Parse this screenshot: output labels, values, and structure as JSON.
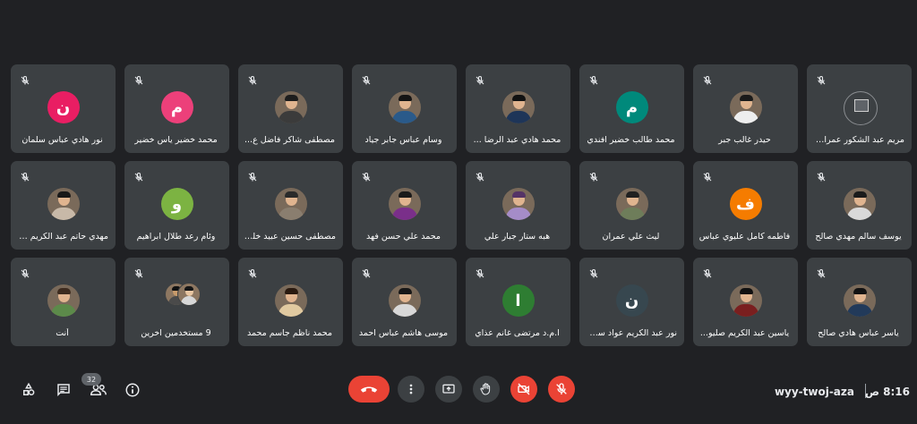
{
  "participants": [
    {
      "name": "مريم عبد الشكور عمران...",
      "avatar": {
        "kind": "broken"
      }
    },
    {
      "name": "حيدر غالب جبر",
      "avatar": {
        "kind": "photo",
        "shirt": "#eeeeee",
        "hair": "#1a1a1a"
      }
    },
    {
      "name": "محمد طالب خضير افندي",
      "avatar": {
        "kind": "letter",
        "letter": "م",
        "color": "#00897b"
      }
    },
    {
      "name": "محمد هادي عبد الرضا ...",
      "avatar": {
        "kind": "photo",
        "shirt": "#1e3558",
        "hair": "#111111"
      }
    },
    {
      "name": "وسام عباس جابر جياد",
      "avatar": {
        "kind": "photo",
        "shirt": "#2a5a8a",
        "hair": "#141414"
      }
    },
    {
      "name": "مصطفى شاكر فاضل ع...",
      "avatar": {
        "kind": "photo",
        "shirt": "#3b3b3b",
        "hair": "#1d1d1d"
      }
    },
    {
      "name": "محمد خضير ياس خضير",
      "avatar": {
        "kind": "letter",
        "letter": "م",
        "color": "#ec407a"
      }
    },
    {
      "name": "نور هادي عباس سلمان",
      "avatar": {
        "kind": "letter",
        "letter": "ن",
        "color": "#e91e63"
      }
    },
    {
      "name": "يوسف سالم مهدي صالح",
      "avatar": {
        "kind": "photo",
        "shirt": "#d9d9d9",
        "hair": "#1b1b1b"
      }
    },
    {
      "name": "فاطمه كامل عليوي عباس",
      "avatar": {
        "kind": "letter",
        "letter": "ف",
        "color": "#f57c00"
      }
    },
    {
      "name": "ليث علي عمران",
      "avatar": {
        "kind": "photo",
        "shirt": "#6e7d5a",
        "hair": "#202020"
      }
    },
    {
      "name": "هبه ستار جبار علي",
      "avatar": {
        "kind": "photo",
        "shirt": "#a58cc8",
        "hair": "#553366"
      }
    },
    {
      "name": "محمد علي حسن فهد",
      "avatar": {
        "kind": "photo",
        "shirt": "#7a2f8a",
        "hair": "#1a1a1a"
      }
    },
    {
      "name": "مصطفى حسين عبيد خليف",
      "avatar": {
        "kind": "photo",
        "shirt": "#8a7e6f",
        "hair": "#2a2a2a"
      }
    },
    {
      "name": "وئام رعد طلال ابراهيم",
      "avatar": {
        "kind": "letter",
        "letter": "و",
        "color": "#7cb342"
      }
    },
    {
      "name": "مهدي حاتم عبد الكريم ه...",
      "avatar": {
        "kind": "photo",
        "shirt": "#c8b9a8",
        "hair": "#181818"
      }
    },
    {
      "name": "ياسر عباس هادي صالح",
      "avatar": {
        "kind": "photo",
        "shirt": "#223a5a",
        "hair": "#121212"
      }
    },
    {
      "name": "ياسين عبد الكريم صليو...",
      "avatar": {
        "kind": "photo",
        "shirt": "#7a1f1f",
        "hair": "#101010"
      }
    },
    {
      "name": "نور عبد الكريم عواد سل...",
      "avatar": {
        "kind": "letter",
        "letter": "ن",
        "color": "#37474f"
      }
    },
    {
      "name": "ا.م.د مرتضى غانم عذاي",
      "avatar": {
        "kind": "letter",
        "letter": "ا",
        "color": "#2e7d32"
      }
    },
    {
      "name": "موسى هاشم عباس احمد",
      "avatar": {
        "kind": "photo",
        "shirt": "#d8d8d8",
        "hair": "#171717"
      }
    },
    {
      "name": "محمد ناظم جاسم محمد",
      "avatar": {
        "kind": "photo",
        "shirt": "#e0c9a0",
        "hair": "#2a1a10"
      }
    },
    {
      "name": "9 مستخدمين آخرين",
      "avatar": {
        "kind": "group"
      }
    },
    {
      "name": "أنت",
      "avatar": {
        "kind": "photo",
        "shirt": "#5c8a4a",
        "hair": "#3d2b1f"
      }
    }
  ],
  "toolbar": {
    "participants_count": "32",
    "meeting_code": "wyy-twoj-aza",
    "time": "8:16 ص"
  },
  "colors": {
    "background": "#202124",
    "tile": "#3c4043",
    "danger": "#ea4335"
  },
  "icons": {
    "tile_status": "mic-off-icon",
    "controls": [
      "end-call-icon",
      "more-options-icon",
      "present-screen-icon",
      "raise-hand-icon",
      "camera-off-icon",
      "mic-off-icon"
    ],
    "side": [
      "activities-icon",
      "chat-icon",
      "people-icon",
      "info-icon"
    ]
  }
}
